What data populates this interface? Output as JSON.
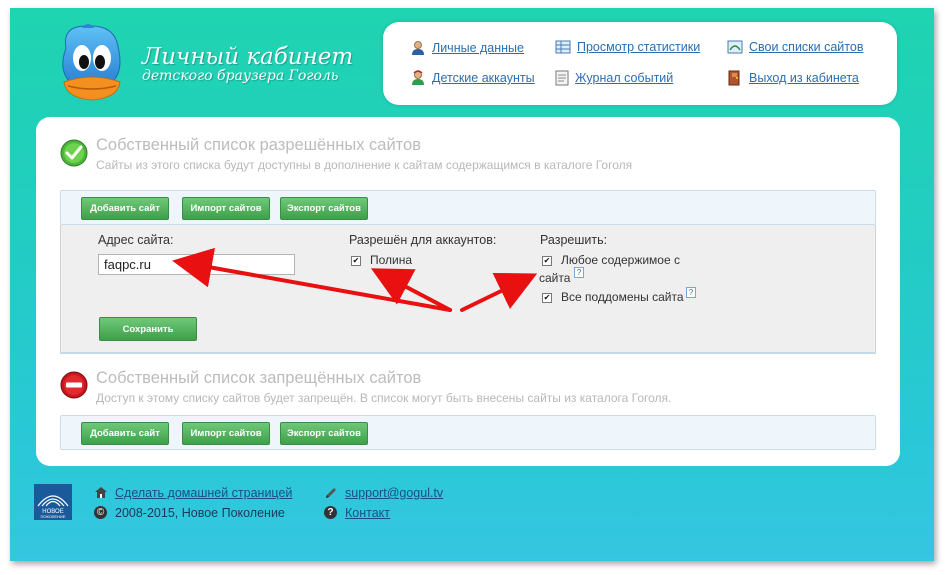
{
  "brand": {
    "title": "Личный кабинет",
    "subtitle": "детского браузера Гоголь"
  },
  "nav": {
    "personal": {
      "label": "Личные данные",
      "icon": "person-icon"
    },
    "stats": {
      "label": "Просмотр статистики",
      "icon": "statistics-icon"
    },
    "lists": {
      "label": "Свои списки сайтов",
      "icon": "site-lists-icon"
    },
    "child_accounts": {
      "label": "Детские аккаунты",
      "icon": "child-account-icon"
    },
    "log": {
      "label": "Журнал событий",
      "icon": "event-log-icon"
    },
    "logout": {
      "label": "Выход из кабинета",
      "icon": "exit-door-icon"
    }
  },
  "allowed": {
    "title": "Собственный список разрешённых сайтов",
    "description": "Сайты из этого списка будут доступны в дополнение к сайтам содержащимся в каталоге Гоголя",
    "toolbar": {
      "add": "Добавить сайт",
      "import": "Импорт сайтов",
      "export": "Экспорт сайтов"
    },
    "form": {
      "address_label": "Адрес сайта:",
      "address_value": "faqpc.ru",
      "accounts_label": "Разрешён для аккаунтов:",
      "accounts": [
        {
          "name": "Полина",
          "checked": true
        }
      ],
      "allow_label": "Разрешить:",
      "allow_any_content_line1": "Любое содержимое с",
      "allow_any_content_line2": "сайта",
      "allow_any_content_checked": true,
      "allow_subdomains": "Все поддомены сайта",
      "allow_subdomains_checked": true,
      "help_glyph": "?",
      "save": "Сохранить"
    }
  },
  "blocked": {
    "title": "Собственный список запрещённых сайтов",
    "description": "Доступ к этому списку сайтов будет запрещён. В список могут быть внесены сайты из каталога Гоголя.",
    "toolbar": {
      "add": "Добавить сайт",
      "import": "Импорт сайтов",
      "export": "Экспорт сайтов"
    }
  },
  "footer": {
    "logo_text_line1": "НОВОЕ",
    "logo_text_line2": "ПОКОЛЕНИЕ",
    "homepage": "Сделать домашней страницей",
    "copyright": "2008-2015, Новое Поколение",
    "copyright_symbol": "©",
    "support": "support@gogul.tv",
    "contact": "Контакт",
    "help_glyph": "?"
  },
  "colors": {
    "accent_green": "#3f9f4a",
    "link_blue": "#2a6fb0",
    "background_top": "#1fd4b0",
    "background_bottom": "#35c6e0",
    "annotation_red": "#e81010"
  }
}
